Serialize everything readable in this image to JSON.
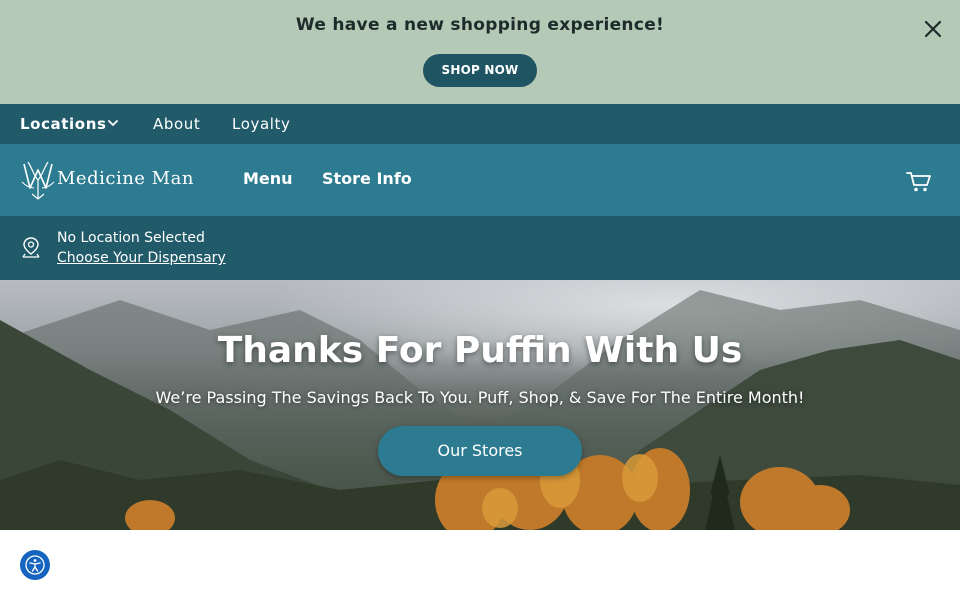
{
  "promo": {
    "message": "We have a new shopping experience!",
    "button_label": "SHOP NOW",
    "close_icon": "close-icon"
  },
  "top_nav": {
    "locations_label": "Locations",
    "about_label": "About",
    "loyalty_label": "Loyalty"
  },
  "main_nav": {
    "logo_text": "Medicine Man",
    "menu_label": "Menu",
    "store_info_label": "Store Info",
    "cart_icon": "cart-icon"
  },
  "location": {
    "status": "No Location Selected",
    "link_label": "Choose Your Dispensary",
    "icon": "map-pin-icon"
  },
  "hero": {
    "title": "Thanks For Puffin With Us",
    "subtitle": "We’re Passing The Savings Back To You. Puff, Shop, & Save For The Entire Month!",
    "button_label": "Our Stores"
  },
  "accessibility": {
    "icon": "accessibility-icon"
  },
  "colors": {
    "promo_bg": "#b5c9b7",
    "dark_teal": "#215b6a",
    "teal": "#2d7b90",
    "accessibility_blue": "#1565c0"
  }
}
